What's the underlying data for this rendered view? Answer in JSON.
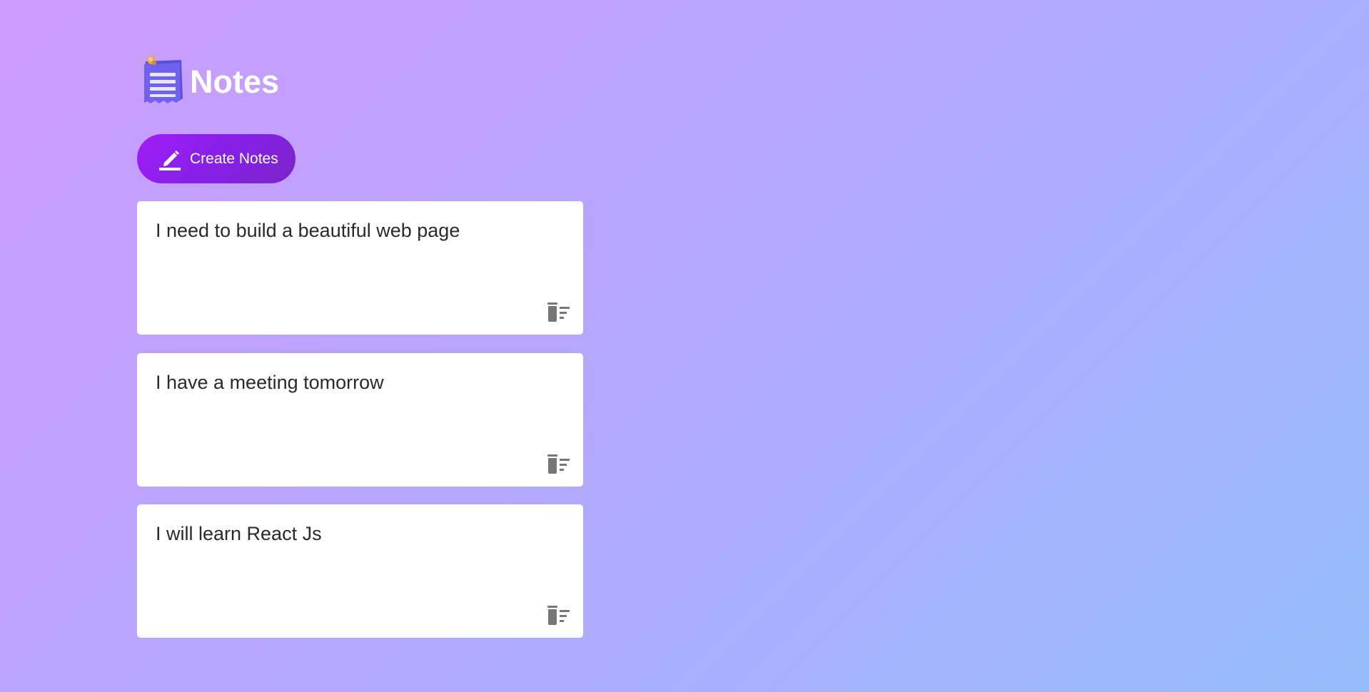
{
  "header": {
    "title": "Notes",
    "logo_icon": "notepad-icon"
  },
  "toolbar": {
    "create_label": "Create Notes",
    "create_icon": "pencil-icon"
  },
  "notes": [
    {
      "text": "I need to build a beautiful web page",
      "delete_icon": "delete-sweep-icon"
    },
    {
      "text": "I have a meeting tomorrow",
      "delete_icon": "delete-sweep-icon"
    },
    {
      "text": "I will learn React Js",
      "delete_icon": "delete-sweep-icon",
      "focused": true
    }
  ],
  "colors": {
    "background_start": "#cd9bfd",
    "background_end": "#96befd",
    "button_start": "#9f1df5",
    "button_end": "#7b24c8",
    "note_bg": "#ffffff",
    "icon_gray": "#777777",
    "text": "#2a2a2a"
  }
}
